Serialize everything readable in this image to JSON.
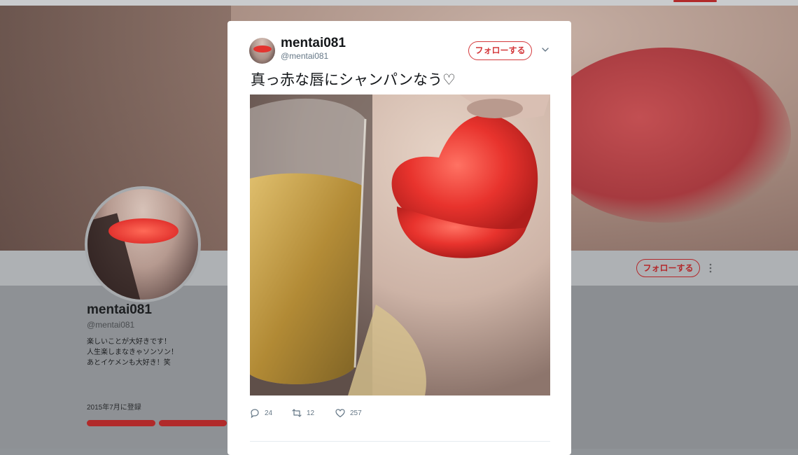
{
  "profile": {
    "name": "mentai081",
    "handle": "@mentai081",
    "bio": [
      "楽しいことが大好きです！",
      "人生楽しまなきゃソンソン！",
      "あとイケメンも大好き！笑"
    ],
    "joined": "2015年7月に登録",
    "follow_label": "フォローする"
  },
  "tweet": {
    "author_name": "mentai081",
    "author_handle": "@mentai081",
    "follow_label": "フォローする",
    "text": "真っ赤な唇にシャンパンなう♡",
    "replies": "24",
    "retweets": "12",
    "likes": "257"
  },
  "icons": {
    "reply": "reply-icon",
    "retweet": "retweet-icon",
    "like": "heart-icon",
    "caret": "chevron-down-icon",
    "more": "more-dots-icon"
  },
  "colors": {
    "accent": "#d4383b",
    "muted": "#657786"
  }
}
